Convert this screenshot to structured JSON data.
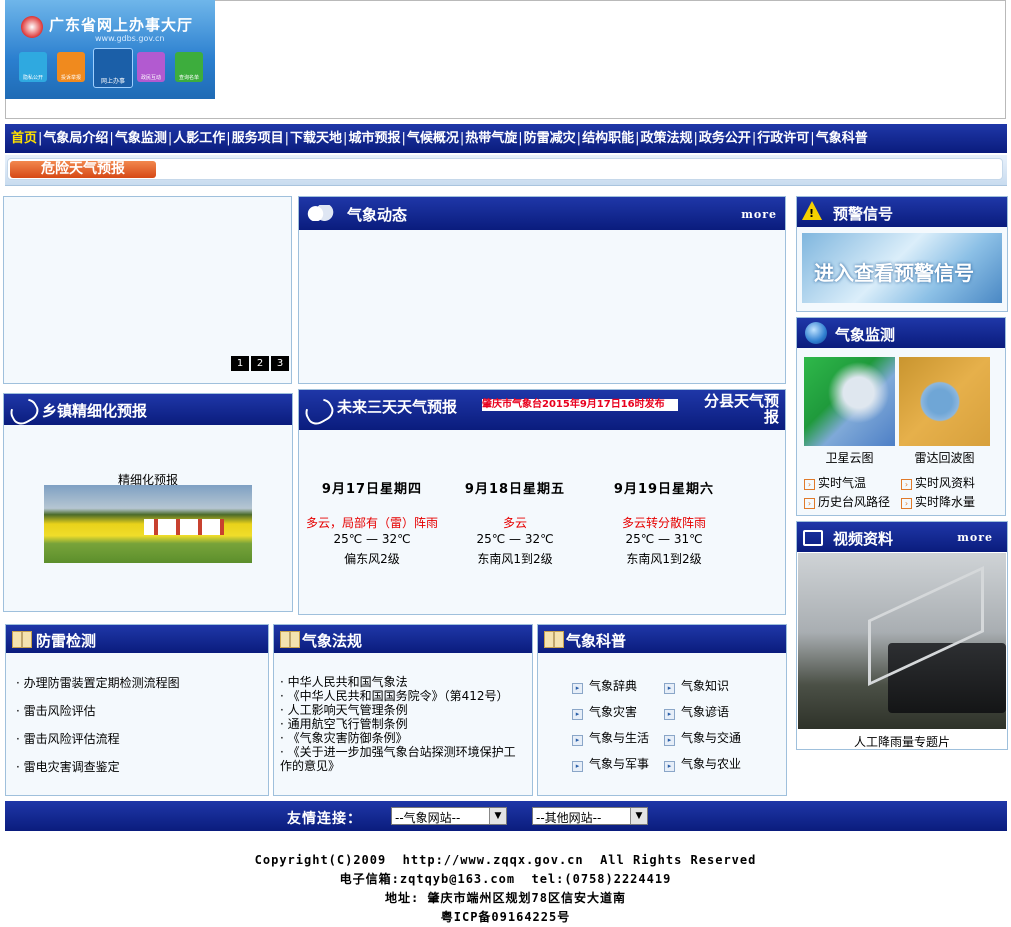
{
  "header": {
    "logo_title": "广东省网上办事大厅",
    "logo_url": "www.gdbs.gov.cn",
    "logo_tiles": [
      "隐私公开",
      "投诉举报",
      "网上办事",
      "政民互动",
      "查询名单"
    ]
  },
  "nav": {
    "items": [
      "首页",
      "气象局介绍",
      "气象监测",
      "人影工作",
      "服务项目",
      "下载天地",
      "城市预报",
      "气候概况",
      "热带气旋",
      "防雷减灾",
      "结构职能",
      "政策法规",
      "政务公开",
      "行政许可",
      "气象科普"
    ]
  },
  "danger_tab": "危险天气预报",
  "slideshow": {
    "pages": [
      "1",
      "2",
      "3"
    ]
  },
  "weather_news": {
    "title": "气象动态",
    "more": "more"
  },
  "warning": {
    "title": "预警信号",
    "banner_text": "进入查看预警信号"
  },
  "monitor": {
    "title": "气象监测",
    "images": [
      "卫星云图",
      "雷达回波图"
    ],
    "links": [
      "实时气温",
      "实时风资料",
      "历史台风路径",
      "实时降水量"
    ]
  },
  "video": {
    "title": "视频资料",
    "more": "more",
    "caption": "人工降雨量专题片"
  },
  "township": {
    "title": "乡镇精细化预报",
    "label": "精细化预报"
  },
  "forecast3": {
    "title": "未来三天天气预报",
    "issued": "肇庆市气象台2015年9月17日16时发布",
    "county_link": "分县天气预报",
    "days": [
      {
        "date": "9月17日星期四",
        "weather": "多云，局部有（雷）阵雨",
        "temp": "25℃ — 32℃",
        "wind": "偏东风2级"
      },
      {
        "date": "9月18日星期五",
        "weather": "多云",
        "temp": "25℃ — 32℃",
        "wind": "东南风1到2级"
      },
      {
        "date": "9月19日星期六",
        "weather": "多云转分散阵雨",
        "temp": "25℃ — 31℃",
        "wind": "东南风1到2级"
      }
    ]
  },
  "lightning": {
    "title": "防雷检测",
    "items": [
      "办理防雷装置定期检测流程图",
      "雷击风险评估",
      "雷击风险评估流程",
      "雷电灾害调查鉴定"
    ]
  },
  "law": {
    "title": "气象法规",
    "items": [
      "中华人民共和国气象法",
      "《中华人民共和国国务院令》（第412号）",
      "人工影响天气管理条例",
      "通用航空飞行管制条例",
      "《气象灾害防御条例》",
      "《关于进一步加强气象台站探测环境保护工作的意见》"
    ]
  },
  "science": {
    "title": "气象科普",
    "items": [
      "气象辞典",
      "气象知识",
      "气象灾害",
      "气象谚语",
      "气象与生活",
      "气象与交通",
      "气象与军事",
      "气象与农业"
    ]
  },
  "friend_links": {
    "label": "友情连接：",
    "select1": "--气象网站--",
    "select2": "--其他网站--"
  },
  "footer": {
    "copyright": "Copyright(C)2009  http://www.zqqx.gov.cn  All Rights Reserved",
    "contact": "电子信箱:zqtqyb@163.com  tel:(0758)2224419",
    "address": "地址: 肇庆市端州区规划78区信安大道南",
    "icp": "粤ICP备09164225号"
  },
  "colors": {
    "nav_blue": "#0d2183",
    "panel_border": "#9fc0dc",
    "red_text": "#e60000",
    "tab_orange": "#e0501e"
  }
}
